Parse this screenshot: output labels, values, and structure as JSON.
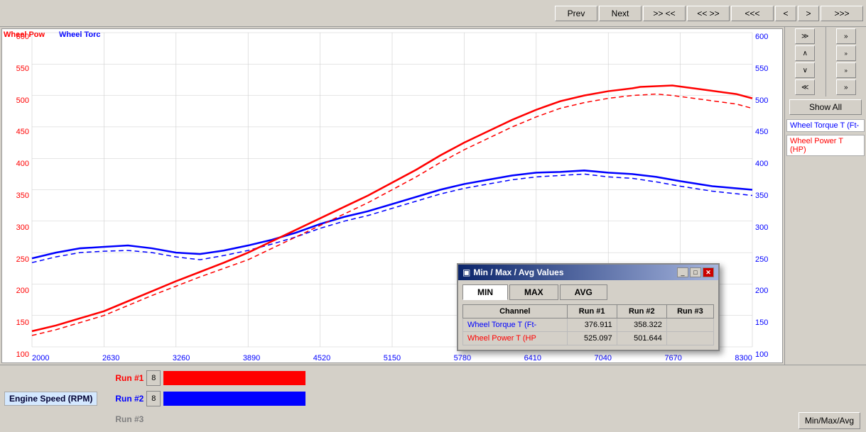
{
  "toolbar": {
    "prev_label": "Prev",
    "next_label": "Next",
    "fast_rev_label": ">> <<",
    "fast_fwd_label": "<< >>",
    "rewind_label": "<<<",
    "left_arrow": "<",
    "right_arrow": ">",
    "fast_right": ">>>"
  },
  "right_panel": {
    "show_all_label": "Show All",
    "legend": [
      {
        "label": "Wheel Torque T (Ft-",
        "color": "blue"
      },
      {
        "label": "Wheel Power T (HP)",
        "color": "red"
      }
    ],
    "icons": {
      "double_up": "≫",
      "up": "∧",
      "down": "∨",
      "double_down": "≪",
      "right_double": "»",
      "right_single": "›"
    }
  },
  "chart": {
    "title_left_red": "Wheel Pow",
    "title_left_blue": "Wheel Torc",
    "y_labels_left": [
      "600",
      "550",
      "500",
      "450",
      "400",
      "350",
      "300",
      "250",
      "200",
      "150",
      "100"
    ],
    "y_labels_right": [
      "600",
      "550",
      "500",
      "450",
      "400",
      "350",
      "300",
      "250",
      "200",
      "150",
      "100"
    ],
    "x_labels": [
      "2000",
      "2630",
      "3260",
      "3890",
      "4520",
      "5150",
      "5780",
      "6410",
      "7040",
      "7670",
      "8300"
    ]
  },
  "modal": {
    "title": "Min / Max / Avg Values",
    "tabs": [
      "MIN",
      "MAX",
      "AVG"
    ],
    "active_tab": "MIN",
    "table": {
      "headers": [
        "Channel",
        "Run #1",
        "Run #2",
        "Run #3"
      ],
      "rows": [
        {
          "channel": "Wheel Torque T (Ft-",
          "channel_color": "blue",
          "run1": "376.911",
          "run2": "358.322",
          "run3": ""
        },
        {
          "channel": "Wheel Power T (HP",
          "channel_color": "red",
          "run1": "525.097",
          "run2": "501.644",
          "run3": ""
        }
      ]
    }
  },
  "bottom": {
    "engine_speed_label": "Engine Speed (RPM)",
    "run1_label": "Run #1",
    "run2_label": "Run #2",
    "run3_label": "Run #3",
    "run_num": "8",
    "min_max_btn": "Min/Max/Avg"
  }
}
